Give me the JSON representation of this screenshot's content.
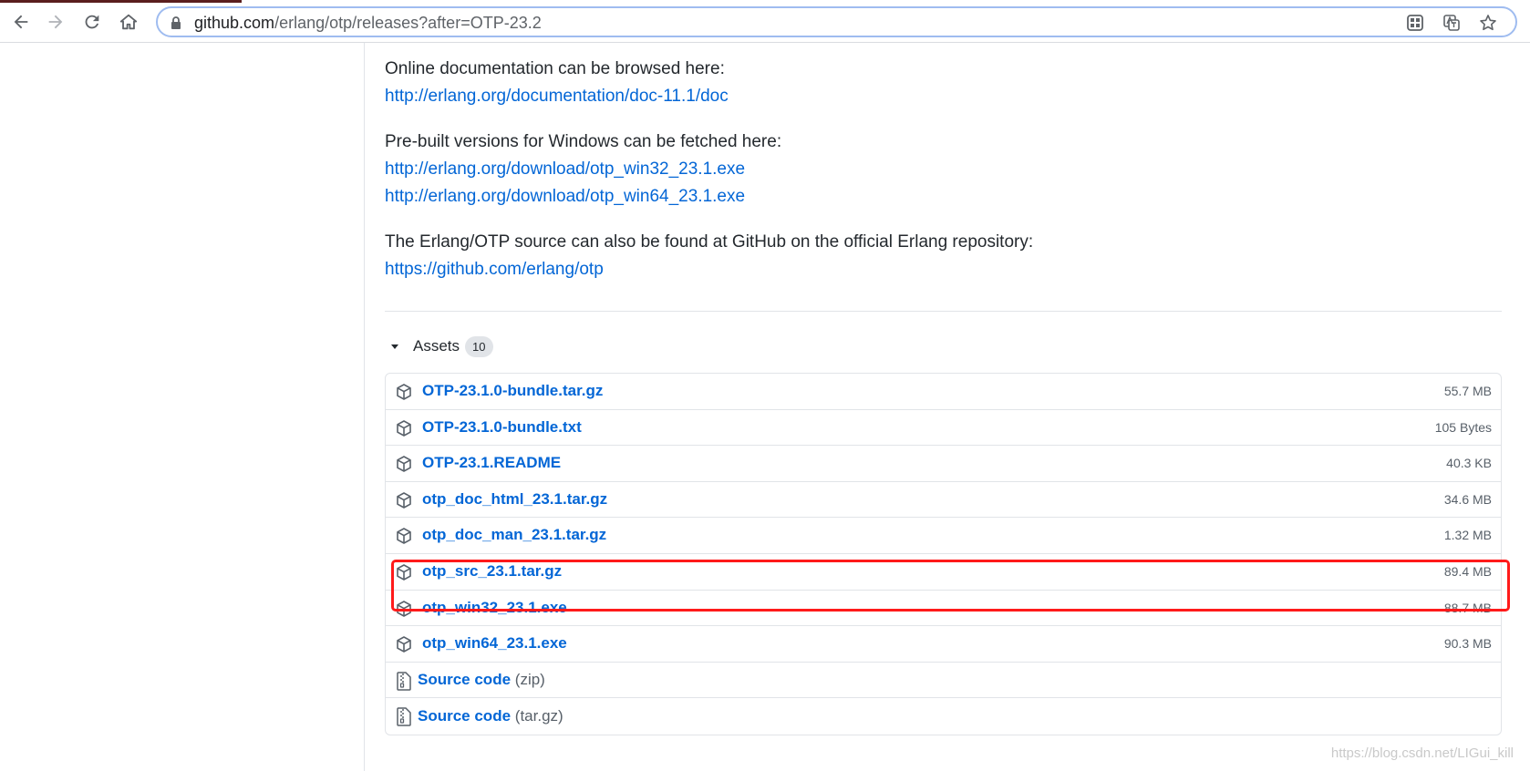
{
  "browser": {
    "url_host": "github.com",
    "url_path": "/erlang/otp/releases?after=OTP-23.2"
  },
  "docs": {
    "online_text": "Online documentation can be browsed here:",
    "online_link": "http://erlang.org/documentation/doc-11.1/doc",
    "prebuilt_text": "Pre-built versions for Windows can be fetched here:",
    "win32_link": "http://erlang.org/download/otp_win32_23.1.exe",
    "win64_link": "http://erlang.org/download/otp_win64_23.1.exe",
    "source_text": "The Erlang/OTP source can also be found at GitHub on the official Erlang repository:",
    "source_link": "https://github.com/erlang/otp"
  },
  "assets": {
    "label": "Assets",
    "count": "10",
    "items": [
      {
        "name": "OTP-23.1.0-bundle.tar.gz",
        "size": "55.7 MB"
      },
      {
        "name": "OTP-23.1.0-bundle.txt",
        "size": "105 Bytes"
      },
      {
        "name": "OTP-23.1.README",
        "size": "40.3 KB"
      },
      {
        "name": "otp_doc_html_23.1.tar.gz",
        "size": "34.6 MB"
      },
      {
        "name": "otp_doc_man_23.1.tar.gz",
        "size": "1.32 MB"
      },
      {
        "name": "otp_src_23.1.tar.gz",
        "size": "89.4 MB"
      },
      {
        "name": "otp_win32_23.1.exe",
        "size": "88.7 MB"
      },
      {
        "name": "otp_win64_23.1.exe",
        "size": "90.3 MB"
      }
    ],
    "source_items": [
      {
        "name": "Source code",
        "kind": "(zip)"
      },
      {
        "name": "Source code",
        "kind": "(tar.gz)"
      }
    ]
  },
  "watermark": "https://blog.csdn.net/LIGui_kill",
  "colors": {
    "link": "#0366d6",
    "highlight": "#ff1a1a"
  }
}
